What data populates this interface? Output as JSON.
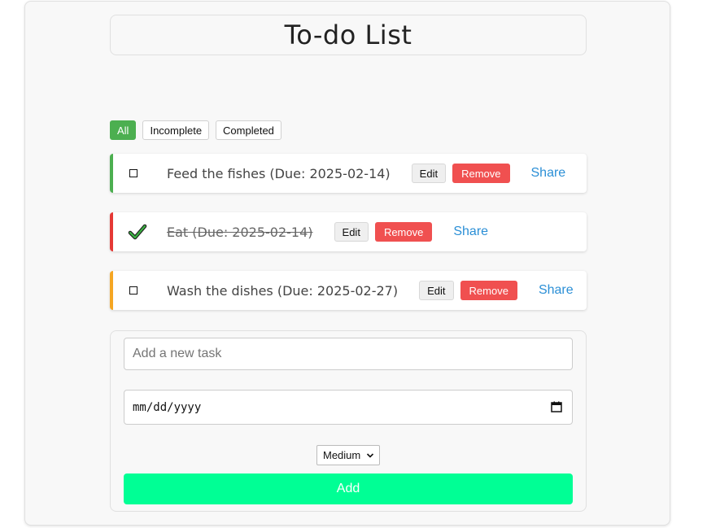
{
  "app": {
    "title": "To-do List"
  },
  "filters": [
    {
      "label": "All",
      "active": true
    },
    {
      "label": "Incomplete",
      "active": false
    },
    {
      "label": "Completed",
      "active": false
    }
  ],
  "tasks": [
    {
      "text": "Feed the fishes (Due: 2025-02-14)",
      "completed": false,
      "priority_color": "#4caf50",
      "edit_label": "Edit",
      "remove_label": "Remove",
      "share_label": "Share"
    },
    {
      "text": "Eat (Due: 2025-02-14)",
      "completed": true,
      "priority_color": "#e53935",
      "edit_label": "Edit",
      "remove_label": "Remove",
      "share_label": "Share"
    },
    {
      "text": "Wash the dishes (Due: 2025-02-27)",
      "completed": false,
      "priority_color": "#f5a623",
      "edit_label": "Edit",
      "remove_label": "Remove",
      "share_label": "Share"
    }
  ],
  "form": {
    "task_placeholder": "Add a new task",
    "task_value": "",
    "date_placeholder": "mm/dd/yyyy",
    "priority_selected": "Medium",
    "add_label": "Add"
  },
  "colors": {
    "active_filter": "#4caf50",
    "remove": "#f05050",
    "share": "#2b8fd6",
    "add": "#00ff95"
  },
  "icons": {
    "checkbox": "checkbox-icon",
    "checkmark": "checkmark-icon",
    "calendar": "calendar-icon",
    "chevron": "chevron-down-icon"
  }
}
